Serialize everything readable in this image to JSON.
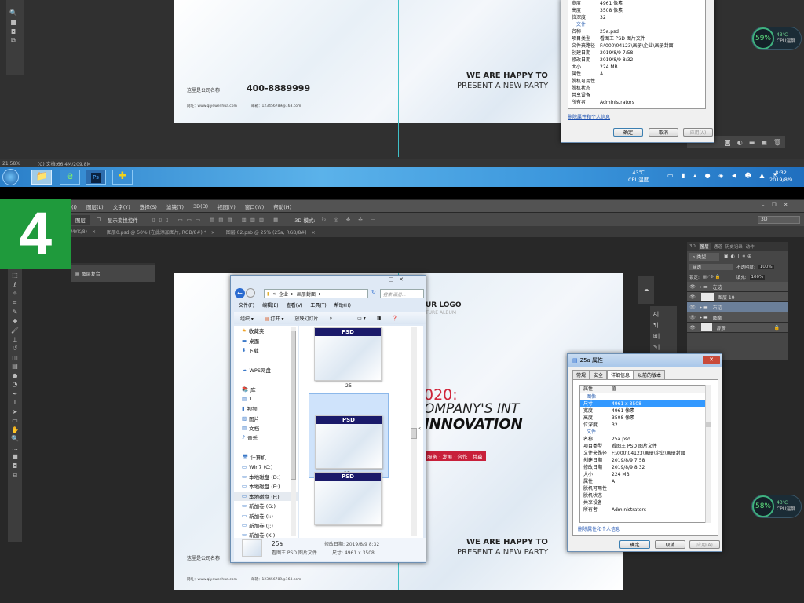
{
  "top": {
    "status": {
      "zoom": "21.58%",
      "doc": "(C) 文档:66.4M/209.8M"
    },
    "cover": {
      "company": "这里是公司名称",
      "phone": "400-8889999",
      "web": "网址：www.qiyewenhua.com",
      "mail": "邮箱：123456789@163.com",
      "happy1": "WE ARE HAPPY TO",
      "happy2": "PRESENT A NEW PARTY"
    },
    "props": {
      "rows": [
        [
          "宽度",
          "4961 像素"
        ],
        [
          "高度",
          "3508 像素"
        ],
        [
          "位深度",
          "32"
        ]
      ],
      "section_file": "文件",
      "file_rows": [
        [
          "名称",
          "25a.psd"
        ],
        [
          "项目类型",
          "看图王 PSD 图片文件"
        ],
        [
          "文件夹路径",
          "F:\\000\\04123\\画册\\企业\\画册封面"
        ],
        [
          "创建日期",
          "2019/8/9 7:58"
        ],
        [
          "修改日期",
          "2019/8/9 8:32"
        ],
        [
          "大小",
          "224 MB"
        ],
        [
          "属性",
          "A"
        ],
        [
          "脱机可用性",
          ""
        ],
        [
          "脱机状态",
          ""
        ],
        [
          "共享设备",
          ""
        ],
        [
          "所有者",
          "Administrators"
        ]
      ],
      "remove_link": "删除属性和个人信息",
      "ok": "确定",
      "cancel": "取消",
      "apply": "应用(A)"
    },
    "cpu": {
      "percent": "59%",
      "temp": "43℃",
      "label": "CPU温度"
    },
    "taskbar": {
      "cpu_temp": "43℃",
      "cpu_label": "CPU温度",
      "time": "8:32",
      "date": "2019/8/9",
      "apps": [
        "start",
        "explorer",
        "360-browser",
        "photoshop",
        "360-safe"
      ]
    }
  },
  "step_badge": "4",
  "ps": {
    "menu": [
      "图像(I)",
      "图层(L)",
      "文字(Y)",
      "选择(S)",
      "滤镜(T)",
      "3D(D)",
      "视图(V)",
      "窗口(W)",
      "帮助(H)"
    ],
    "options": {
      "layer_select": "图层",
      "show_transform": "显示变换控件",
      "mode3d": "3D 模式:",
      "workspace": "3D"
    },
    "tabs": [
      "MYK/8)",
      "图册0.psd @ 50% (在此添加图片, RGB/8#) *",
      "图层 02.psb @ 25% (25a, RGB/8#)"
    ],
    "comp_panel": "图层复合",
    "layers_panel": {
      "tabs": [
        "3D",
        "图层",
        "通道",
        "历史记录",
        "动作"
      ],
      "kind": "类型",
      "blend": "穿透",
      "opacity_label": "不透明度:",
      "opacity": "100%",
      "lock_label": "锁定:",
      "fill_label": "填充:",
      "fill": "100%",
      "layers": [
        {
          "name": "左边",
          "type": "group"
        },
        {
          "name": "图层 19",
          "type": "layer"
        },
        {
          "name": "右边",
          "type": "group",
          "selected": true
        },
        {
          "name": "图案",
          "type": "group"
        },
        {
          "name": "背景",
          "type": "background"
        }
      ]
    },
    "cpu": {
      "percent": "58%",
      "temp": "43℃",
      "label": "CPU温度"
    }
  },
  "cover": {
    "logo": "UR LOGO",
    "logo_sub": "TURE ALBUM",
    "year": "020:",
    "line1": "OMPANY'S INT",
    "line2": "INNOVATION",
    "tag": "服务 · 发展 · 合作 · 共赢",
    "company": "这里是公司名称",
    "web": "网址：www.qiyewenhua.com",
    "mail": "邮箱：123456789@163.com",
    "happy1": "WE ARE HAPPY TO",
    "happy2": "PRESENT A NEW PARTY"
  },
  "explorer": {
    "path": [
      "企业",
      "画册封面"
    ],
    "search": "搜索 画册...",
    "menu": [
      "文件(F)",
      "编辑(E)",
      "查看(V)",
      "工具(T)",
      "帮助(H)"
    ],
    "toolbar": {
      "organize": "组织",
      "open": "打开",
      "slideshow": "放映幻灯片",
      "more": "»"
    },
    "nav": [
      {
        "label": "收藏夹",
        "icon": "star"
      },
      {
        "label": "桌面",
        "icon": "desktop"
      },
      {
        "label": "下载",
        "icon": "download"
      },
      {
        "label": "",
        "icon": ""
      },
      {
        "label": "WPS网盘",
        "icon": "cloud"
      },
      {
        "label": "",
        "icon": ""
      },
      {
        "label": "库",
        "icon": "library"
      },
      {
        "label": "1",
        "icon": "doc"
      },
      {
        "label": "视频",
        "icon": "video"
      },
      {
        "label": "图片",
        "icon": "picture"
      },
      {
        "label": "文档",
        "icon": "doc"
      },
      {
        "label": "音乐",
        "icon": "music"
      },
      {
        "label": "",
        "icon": ""
      },
      {
        "label": "计算机",
        "icon": "computer"
      },
      {
        "label": "Win7 (C:)",
        "icon": "drive"
      },
      {
        "label": "本地磁盘 (D:)",
        "icon": "drive"
      },
      {
        "label": "本地磁盘 (E:)",
        "icon": "drive"
      },
      {
        "label": "本地磁盘 (F:)",
        "icon": "drive",
        "selected": true
      },
      {
        "label": "新加卷 (G:)",
        "icon": "drive"
      },
      {
        "label": "新加卷 (I:)",
        "icon": "drive"
      },
      {
        "label": "新加卷 (J:)",
        "icon": "drive"
      },
      {
        "label": "新加卷 (K:)",
        "icon": "drive"
      }
    ],
    "files": [
      {
        "name": "25",
        "badge": "PSD"
      },
      {
        "name": "25a",
        "badge": "PSD",
        "selected": true
      },
      {
        "name": "",
        "badge": "PSD"
      }
    ],
    "details": {
      "name": "25a",
      "type": "看图王 PSD 图片文件",
      "modified": "修改日期: 2019/8/9 8:32",
      "size": "尺寸: 4961 x 3508"
    }
  },
  "props": {
    "title": "25a 属性",
    "tabs": [
      "常规",
      "安全",
      "详细信息",
      "以前的版本"
    ],
    "active_tab": 2,
    "header": [
      "属性",
      "值"
    ],
    "section_image": "图像",
    "image_rows": [
      [
        "尺寸",
        "4961 x 3508"
      ],
      [
        "宽度",
        "4961 像素"
      ],
      [
        "高度",
        "3508 像素"
      ],
      [
        "位深度",
        "32"
      ]
    ],
    "section_file": "文件",
    "file_rows": [
      [
        "名称",
        "25a.psd"
      ],
      [
        "项目类型",
        "看图王 PSD 图片文件"
      ],
      [
        "文件夹路径",
        "F:\\000\\04123\\画册\\企业\\画册封面"
      ],
      [
        "创建日期",
        "2019/8/9 7:58"
      ],
      [
        "修改日期",
        "2019/8/9 8:32"
      ],
      [
        "大小",
        "224 MB"
      ],
      [
        "属性",
        "A"
      ],
      [
        "脱机可用性",
        ""
      ],
      [
        "脱机状态",
        ""
      ],
      [
        "共享设备",
        ""
      ],
      [
        "所有者",
        "Administrators"
      ]
    ],
    "remove_link": "删除属性和个人信息",
    "ok": "确定",
    "cancel": "取消",
    "apply": "应用(A)"
  }
}
